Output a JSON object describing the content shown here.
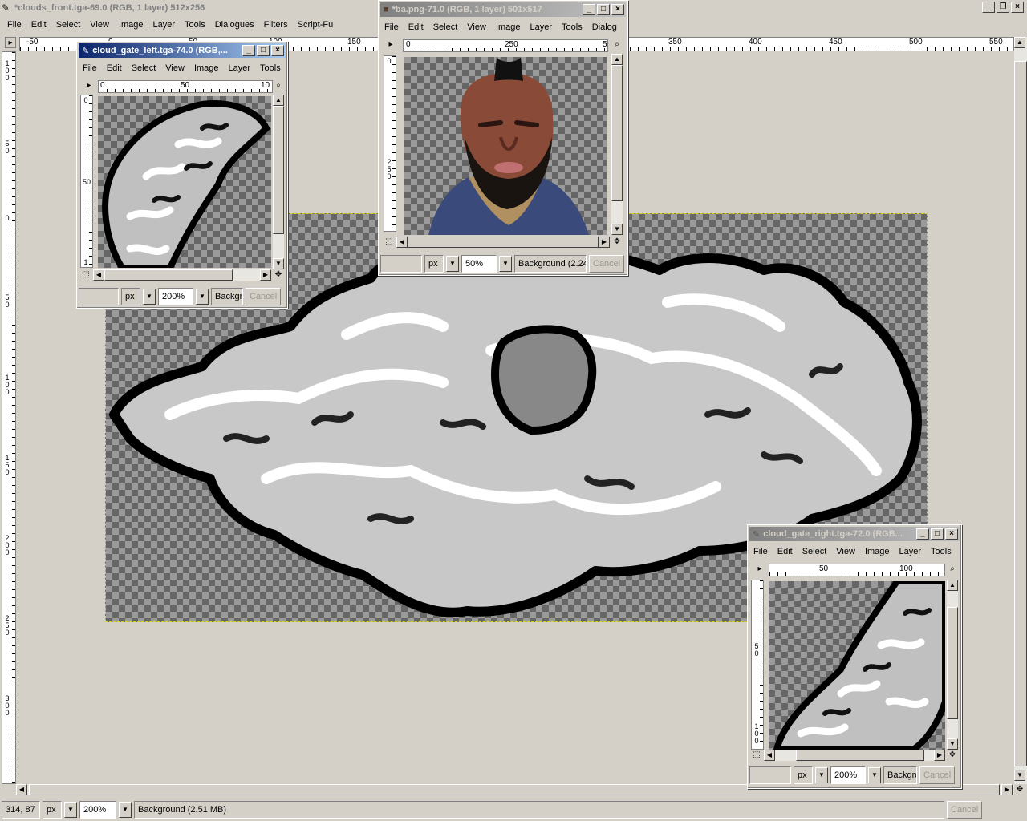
{
  "main": {
    "title": "*clouds_front.tga-69.0 (RGB, 1 layer) 512x256",
    "menu": [
      "File",
      "Edit",
      "Select",
      "View",
      "Image",
      "Layer",
      "Tools",
      "Dialogues",
      "Filters",
      "Script-Fu"
    ],
    "hruler": [
      "-50",
      "0",
      "50",
      "100",
      "150",
      "350",
      "400",
      "450",
      "500",
      "550"
    ],
    "vruler": [
      "100",
      "50",
      "0",
      "50",
      "100",
      "150",
      "200",
      "250",
      "300"
    ],
    "status": {
      "coords": "314, 87",
      "unit": "px",
      "zoom": "200%",
      "info": "Background (2.51 MB)",
      "cancel": "Cancel"
    }
  },
  "left_window": {
    "title": "cloud_gate_left.tga-74.0 (RGB,...",
    "menu": [
      "File",
      "Edit",
      "Select",
      "View",
      "Image",
      "Layer",
      "Tools"
    ],
    "hruler": [
      "0",
      "50",
      "10"
    ],
    "vruler": [
      "0",
      "50",
      "1"
    ],
    "status": {
      "unit": "px",
      "zoom": "200%",
      "info": "Backgro",
      "cancel": "Cancel"
    }
  },
  "ba_window": {
    "title": "*ba.png-71.0 (RGB, 1 layer) 501x517",
    "menu": [
      "File",
      "Edit",
      "Select",
      "View",
      "Image",
      "Layer",
      "Tools",
      "Dialog"
    ],
    "hruler": [
      "0",
      "250",
      "5"
    ],
    "vruler": [
      "0",
      "250"
    ],
    "status": {
      "unit": "px",
      "zoom": "50%",
      "info": "Background (2.24",
      "cancel": "Cancel"
    }
  },
  "right_window": {
    "title": "cloud_gate_right.tga-72.0 (RGB...",
    "menu": [
      "File",
      "Edit",
      "Select",
      "View",
      "Image",
      "Layer",
      "Tools"
    ],
    "hruler": [
      "50",
      "100"
    ],
    "vruler": [
      "50",
      "100"
    ],
    "status": {
      "unit": "px",
      "zoom": "200%",
      "info": "Backgro",
      "cancel": "Cancel"
    }
  },
  "top_right_controls": [
    "_",
    "❐",
    "×"
  ]
}
